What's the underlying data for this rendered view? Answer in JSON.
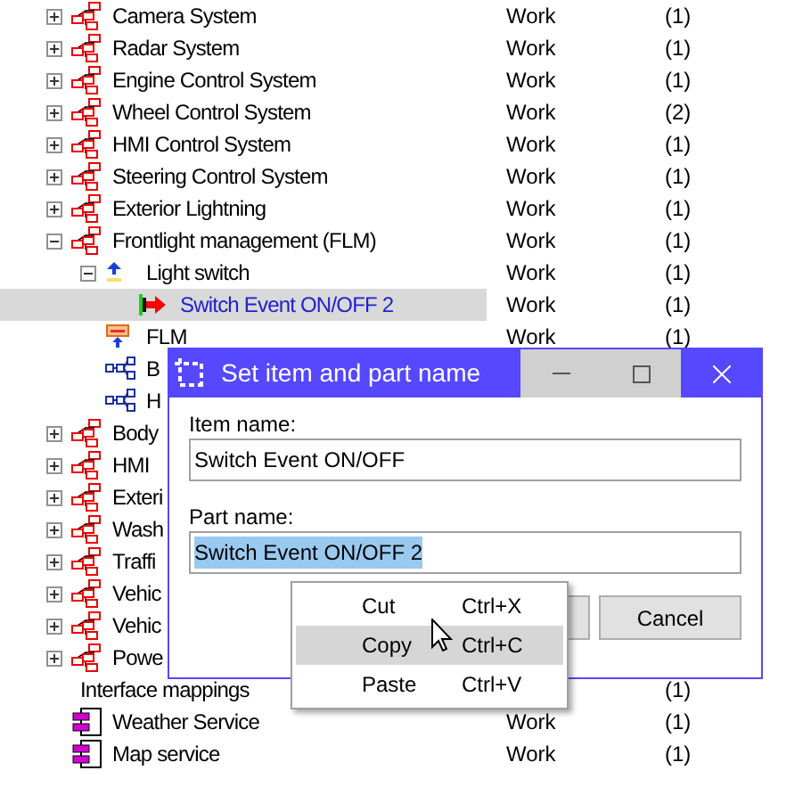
{
  "tree": {
    "items": [
      {
        "label": "Camera System",
        "kind": "system",
        "expanded": false,
        "type": "Work",
        "count": "(1)"
      },
      {
        "label": "Radar System",
        "kind": "system",
        "expanded": false,
        "type": "Work",
        "count": "(1)"
      },
      {
        "label": "Engine Control System",
        "kind": "system",
        "expanded": false,
        "type": "Work",
        "count": "(1)"
      },
      {
        "label": "Wheel Control System",
        "kind": "system",
        "expanded": false,
        "type": "Work",
        "count": "(2)"
      },
      {
        "label": "HMI Control System",
        "kind": "system",
        "expanded": false,
        "type": "Work",
        "count": "(1)"
      },
      {
        "label": "Steering Control System",
        "kind": "system",
        "expanded": false,
        "type": "Work",
        "count": "(1)"
      },
      {
        "label": "Exterior Lightning",
        "kind": "system",
        "expanded": false,
        "type": "Work",
        "count": "(1)"
      },
      {
        "label": "Frontlight management (FLM)",
        "kind": "system",
        "expanded": true,
        "type": "Work",
        "count": "(1)",
        "children": [
          {
            "label": "Light switch",
            "kind": "signal",
            "expanded": true,
            "type": "Work",
            "count": "(1)",
            "children": [
              {
                "label": "Switch Event ON/OFF 2",
                "kind": "event",
                "selected": true,
                "type": "Work",
                "count": "(1)"
              }
            ]
          },
          {
            "label": "FLM",
            "kind": "block",
            "type": "Work",
            "count": "(1)"
          },
          {
            "label": "B",
            "kind": "network"
          },
          {
            "label": "H",
            "kind": "network"
          }
        ]
      },
      {
        "label": "Body",
        "kind": "system",
        "expanded": false
      },
      {
        "label": "HMI",
        "kind": "system",
        "expanded": false
      },
      {
        "label": "Exteri",
        "kind": "system",
        "expanded": false
      },
      {
        "label": "Wash",
        "kind": "system",
        "expanded": false
      },
      {
        "label": "Traffi",
        "kind": "system",
        "expanded": false
      },
      {
        "label": "Vehic",
        "kind": "system",
        "expanded": false
      },
      {
        "label": "Vehic",
        "kind": "system",
        "expanded": false
      },
      {
        "label": "Powe",
        "kind": "system",
        "expanded": false
      },
      {
        "label": "Interface mappings",
        "kind": "none",
        "count": "(1)"
      },
      {
        "label": "Weather Service",
        "kind": "service",
        "type": "Work",
        "count": "(1)"
      },
      {
        "label": "Map service",
        "kind": "service",
        "type": "Work",
        "count": "(1)"
      }
    ]
  },
  "dialog": {
    "title": "Set item and part name",
    "item_label": "Item name:",
    "item_value": "Switch Event ON/OFF",
    "part_label": "Part name:",
    "part_value": "Switch Event ON/OFF 2",
    "part_selected": true,
    "cancel": "Cancel"
  },
  "context_menu": {
    "items": [
      {
        "label": "Cut",
        "shortcut": "Ctrl+X",
        "selected": false
      },
      {
        "label": "Copy",
        "shortcut": "Ctrl+C",
        "selected": true
      },
      {
        "label": "Paste",
        "shortcut": "Ctrl+V",
        "selected": false
      }
    ]
  }
}
